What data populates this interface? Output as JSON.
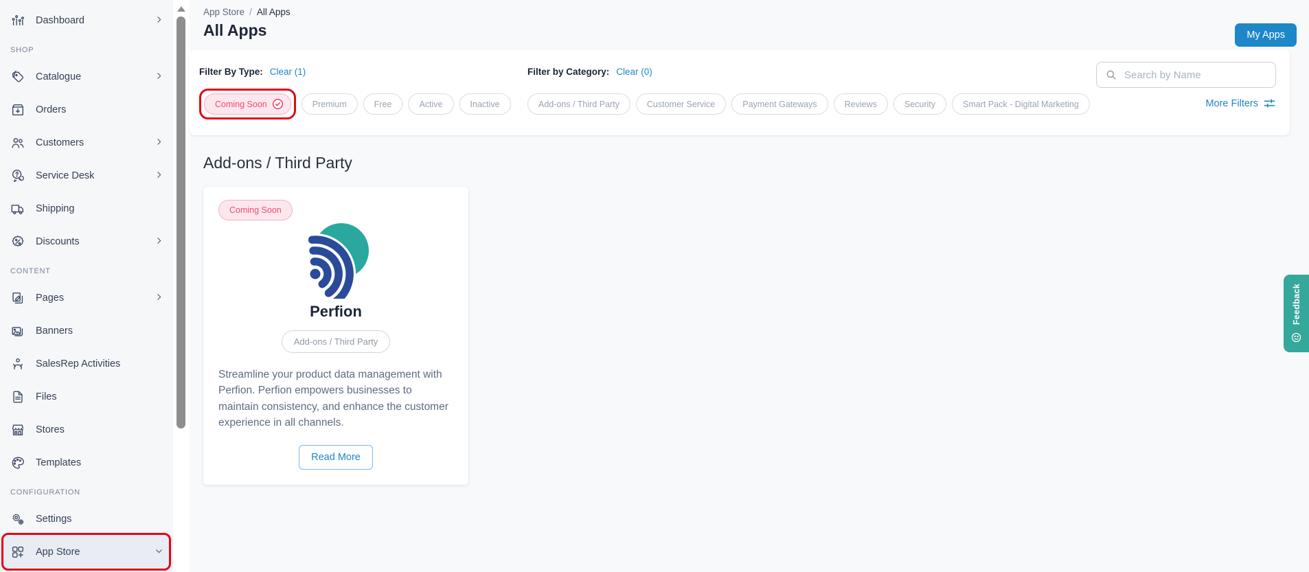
{
  "colors": {
    "accent_blue": "#1d87c8",
    "selected_pink": "#ee4b71",
    "annotation_red": "#e30613",
    "feedback_teal": "#35a79b",
    "logo_teal": "#2aa89f",
    "logo_blue": "#2a4b9a"
  },
  "sidebar": {
    "section_labels": [
      "SHOP",
      "CONTENT",
      "CONFIGURATION"
    ],
    "items": [
      {
        "label": "Dashboard"
      },
      {
        "label": "Catalogue"
      },
      {
        "label": "Orders"
      },
      {
        "label": "Customers"
      },
      {
        "label": "Service Desk"
      },
      {
        "label": "Shipping"
      },
      {
        "label": "Discounts"
      },
      {
        "label": "Pages"
      },
      {
        "label": "Banners"
      },
      {
        "label": "SalesRep Activities"
      },
      {
        "label": "Files"
      },
      {
        "label": "Stores"
      },
      {
        "label": "Templates"
      },
      {
        "label": "Settings"
      },
      {
        "label": "App Store"
      }
    ]
  },
  "breadcrumb": {
    "parent": "App Store",
    "separator": "/",
    "current": "All Apps"
  },
  "page": {
    "title": "All Apps",
    "my_apps_button": "My Apps"
  },
  "filters": {
    "type": {
      "label": "Filter By Type:",
      "clear": "Clear (1)",
      "chips": [
        {
          "label": "Coming Soon",
          "selected": true
        },
        {
          "label": "Premium"
        },
        {
          "label": "Free"
        },
        {
          "label": "Active"
        },
        {
          "label": "Inactive"
        }
      ]
    },
    "category": {
      "label": "Filter by Category:",
      "clear": "Clear (0)",
      "chips": [
        {
          "label": "Add-ons / Third Party"
        },
        {
          "label": "Customer Service"
        },
        {
          "label": "Payment Gateways"
        },
        {
          "label": "Reviews"
        },
        {
          "label": "Security"
        },
        {
          "label": "Smart Pack - Digital Marketing"
        }
      ]
    },
    "search": {
      "placeholder": "Search by Name"
    },
    "more_filters": "More Filters"
  },
  "section": {
    "heading": "Add-ons / Third Party"
  },
  "app_card": {
    "badge": "Coming Soon",
    "name": "Perfion",
    "category": "Add-ons / Third Party",
    "description": "Streamline your product data management with Perfion. Perfion empowers businesses to maintain consistency, and enhance the customer experience in all channels.",
    "read_more": "Read More"
  },
  "feedback_tab": {
    "label": "Feedback"
  },
  "icons": {
    "search": "magnifier",
    "more_filters": "sliders",
    "selected_chip": "check-circle",
    "feedback": "smiley-face",
    "sidebar_expand": "chevron-right",
    "app_store_expanded": "chevron-down"
  }
}
